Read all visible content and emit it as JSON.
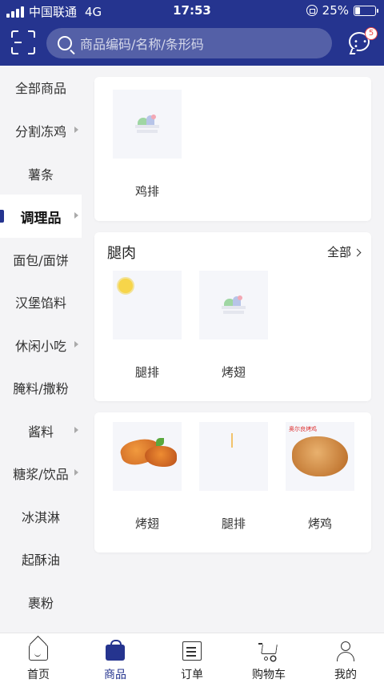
{
  "status_bar": {
    "carrier": "中国联通",
    "network": "4G",
    "time": "17:53",
    "battery": "25%",
    "battery_level": 0.25
  },
  "header": {
    "search_placeholder": "商品编码/名称/条形码",
    "message_badge": "5",
    "accent_color": "#25348f"
  },
  "sidebar": {
    "items": [
      {
        "label": "全部商品",
        "has_arrow": false
      },
      {
        "label": "分割冻鸡",
        "has_arrow": true
      },
      {
        "label": "薯条",
        "has_arrow": false
      },
      {
        "label": "调理品",
        "has_arrow": true,
        "active": true
      },
      {
        "label": "面包/面饼",
        "has_arrow": false
      },
      {
        "label": "汉堡馅料",
        "has_arrow": false
      },
      {
        "label": "休闲小吃",
        "has_arrow": true
      },
      {
        "label": "腌料/撒粉",
        "has_arrow": false
      },
      {
        "label": "酱料",
        "has_arrow": true
      },
      {
        "label": "糖浆/饮品",
        "has_arrow": true
      },
      {
        "label": "冰淇淋",
        "has_arrow": false
      },
      {
        "label": "起酥油",
        "has_arrow": false
      },
      {
        "label": "裹粉",
        "has_arrow": false
      }
    ]
  },
  "sections": [
    {
      "title": "",
      "products": [
        {
          "name": "鸡排",
          "image": "placeholder-icon"
        }
      ]
    },
    {
      "title": "腿肉",
      "all_label": "全部",
      "products": [
        {
          "name": "腿排",
          "image": "fried-chicken-steak-photo"
        },
        {
          "name": "烤翅",
          "image": "placeholder-icon"
        }
      ]
    },
    {
      "title": "",
      "products": [
        {
          "name": "烤翅",
          "image": "roast-wings-photo"
        },
        {
          "name": "腿排",
          "image": "glazed-leg-steak-photo"
        },
        {
          "name": "烤鸡",
          "image": "roast-chicken-photo",
          "image_text": "奥尔良烤鸡"
        }
      ]
    }
  ],
  "tabbar": {
    "tabs": [
      {
        "label": "首页",
        "icon": "home-icon"
      },
      {
        "label": "商品",
        "icon": "bag-icon",
        "active": true
      },
      {
        "label": "订单",
        "icon": "order-icon"
      },
      {
        "label": "购物车",
        "icon": "cart-icon"
      },
      {
        "label": "我的",
        "icon": "profile-icon"
      }
    ]
  }
}
